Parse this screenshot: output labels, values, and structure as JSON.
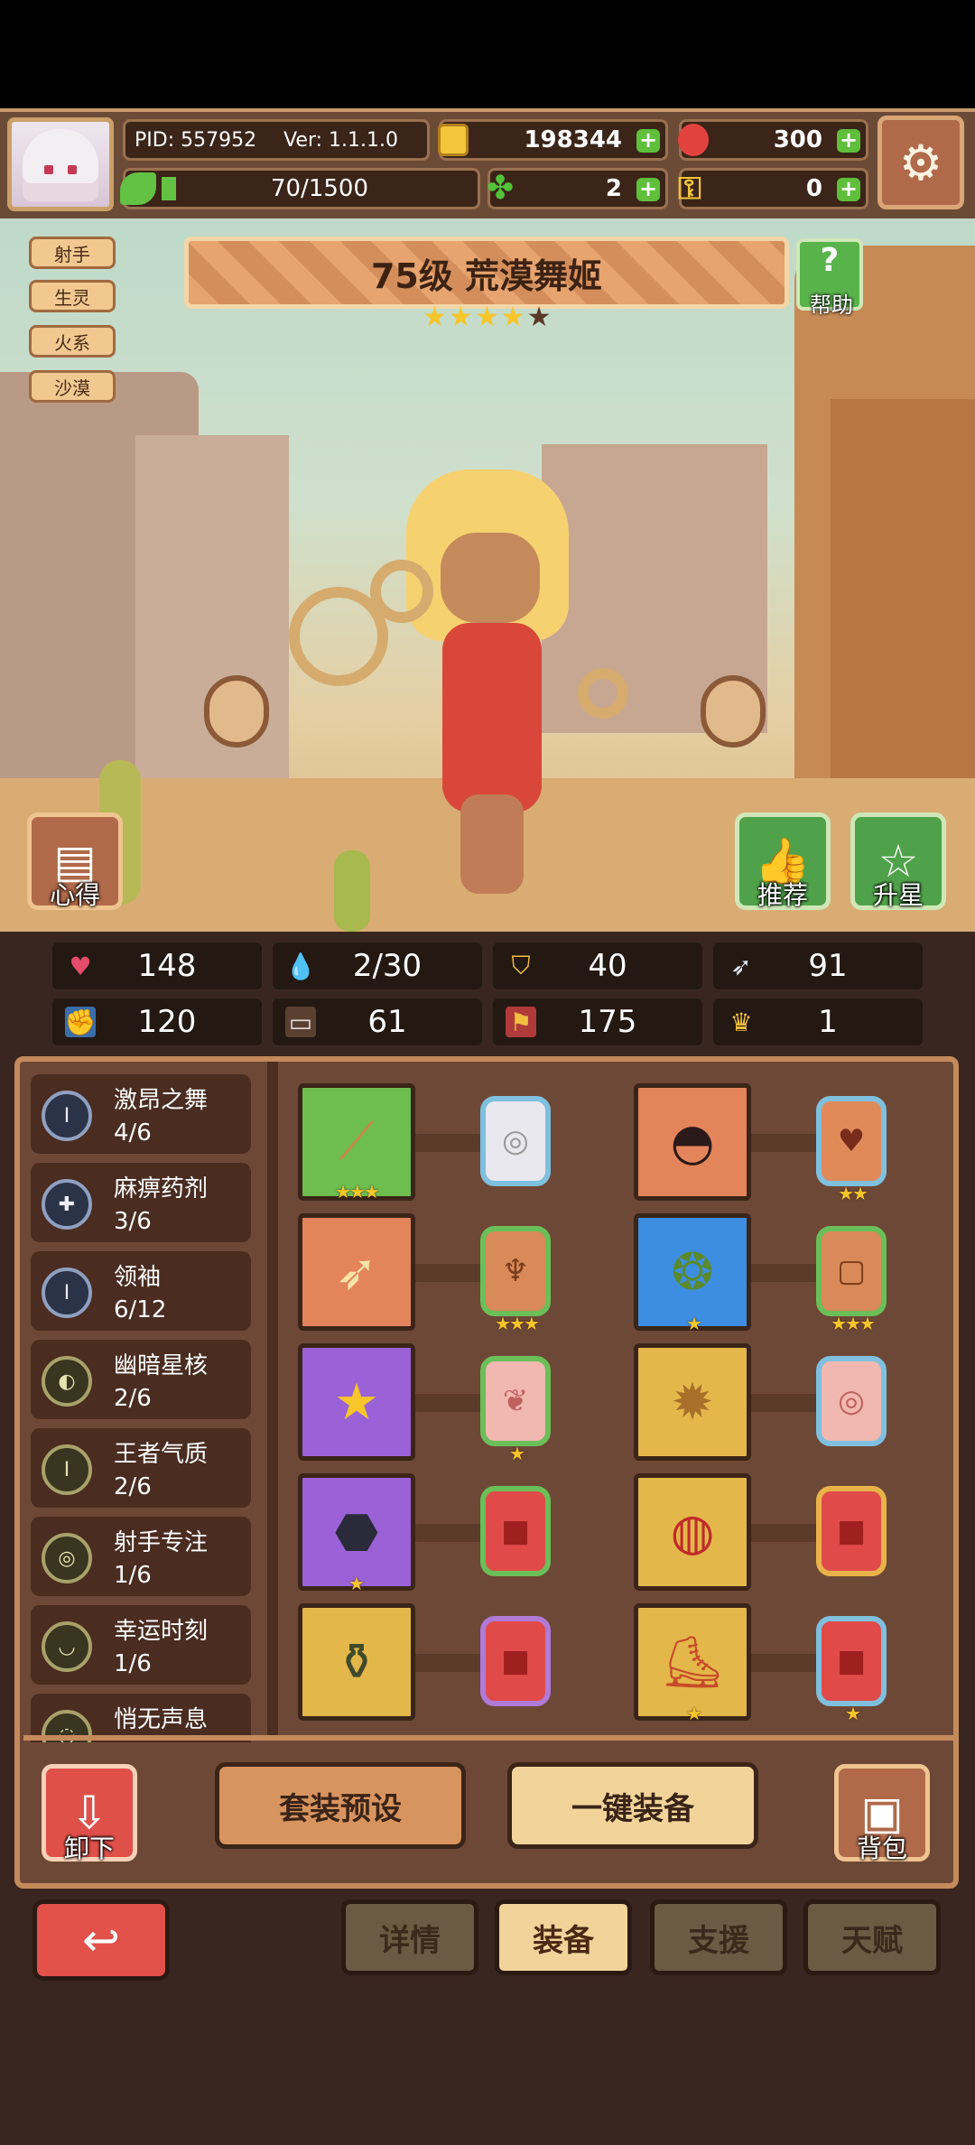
{
  "header": {
    "pid": "PID: 557952",
    "version": "Ver: 1.1.1.0",
    "coins": "198344",
    "gems": "300",
    "energy": "70/1500",
    "energy_fraction": 0.047,
    "clovers": "2",
    "keys": "0"
  },
  "character": {
    "tags": [
      "射手",
      "生灵",
      "火系",
      "沙漠"
    ],
    "title": "75级  荒漠舞姬",
    "stars_filled": 4,
    "stars_total": 5,
    "help_label": "帮助",
    "insight_label": "心得",
    "recommend_label": "推荐",
    "upgrade_star_label": "升星"
  },
  "stats": [
    {
      "icon": "heart-icon",
      "value": "148"
    },
    {
      "icon": "water-drop-icon",
      "value": "2/30"
    },
    {
      "icon": "shield-icon",
      "value": "40"
    },
    {
      "icon": "wing-icon",
      "value": "91"
    },
    {
      "icon": "fist-icon",
      "value": "120"
    },
    {
      "icon": "book-icon",
      "value": "61"
    },
    {
      "icon": "flag-icon",
      "value": "175"
    },
    {
      "icon": "crown-icon",
      "value": "1"
    }
  ],
  "sets": [
    {
      "name": "激昂之舞",
      "count": "4/6"
    },
    {
      "name": "麻痹药剂",
      "count": "3/6"
    },
    {
      "name": "领袖",
      "count": "6/12"
    },
    {
      "name": "幽暗星核",
      "count": "2/6"
    },
    {
      "name": "王者气质",
      "count": "2/6"
    },
    {
      "name": "射手专注",
      "count": "1/6"
    },
    {
      "name": "幸运时刻",
      "count": "1/6"
    },
    {
      "name": "悄无声息",
      "count": ""
    }
  ],
  "actions": {
    "unequip": "卸下",
    "preset": "套装预设",
    "auto_equip": "一键装备",
    "backpack": "背包"
  },
  "tabs": {
    "details": "详情",
    "equipment": "装备",
    "support": "支援",
    "talent": "天赋"
  }
}
